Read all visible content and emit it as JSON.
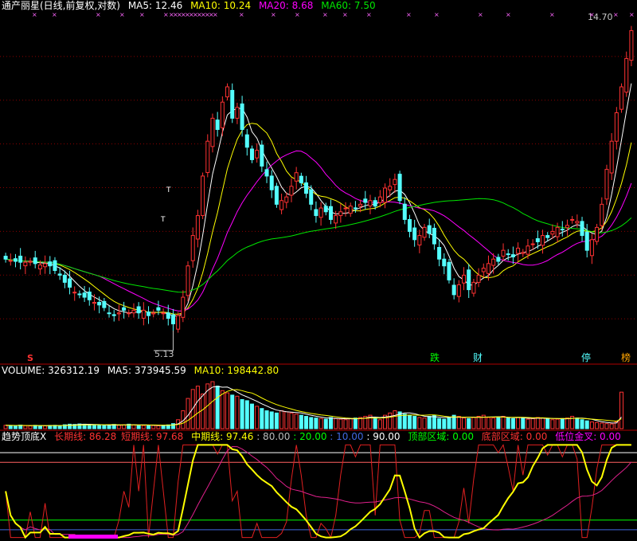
{
  "colors": {
    "up": "#ff3232",
    "down": "#54ffff",
    "ma5": "#ffffff",
    "ma10": "#ffff00",
    "ma20": "#ff00ff",
    "ma60": "#00e600",
    "grid": "#8b0000",
    "panel_border": "#b00000"
  },
  "main_header": {
    "title": "通产丽星(日线,前复权,对数)",
    "ma5": "MA5: 12.46",
    "ma10": "MA10: 10.24",
    "ma20": "MA20: 8.68",
    "ma60": "MA60: 7.50"
  },
  "volume_header": {
    "title": "VOLUME: 326312.19",
    "ma5": "MA5: 373945.59",
    "ma10": "MA10: 198442.80"
  },
  "indicator_header": {
    "title": "趋势顶底X",
    "long": "长期线: 86.28",
    "short": "短期线: 97.68",
    "mid": "中期线: 97.46",
    "l80": ": 80.00",
    "l20": ": 20.00",
    "l10": ": 10.00",
    "l90": ": 90.00",
    "top": "顶部区域: 0.00",
    "bottom": "底部区域: 0.00",
    "cross": "低位金叉: 0.00"
  },
  "annotations": {
    "low_label": "5.13",
    "high_label": "14.70",
    "marker_s": "S",
    "marker_die": "跌",
    "marker_cai": "财",
    "marker_ting": "停",
    "marker_bang": "榜",
    "t_mark": "T"
  },
  "chart_data": [
    {
      "type": "candlestick",
      "title": "通产丽星(日线,前复权,对数)",
      "scale": "log",
      "y_range": [
        4.6,
        15.2
      ],
      "low": 5.13,
      "high": 14.7,
      "closes": [
        6.55,
        6.52,
        6.5,
        6.48,
        6.48,
        6.5,
        6.45,
        6.42,
        6.45,
        6.4,
        6.3,
        6.2,
        6.05,
        5.95,
        5.85,
        5.8,
        5.75,
        5.7,
        5.65,
        5.6,
        5.55,
        5.45,
        5.4,
        5.45,
        5.5,
        5.45,
        5.5,
        5.45,
        5.5,
        5.4,
        5.45,
        5.5,
        5.45,
        5.35,
        5.25,
        5.4,
        5.75,
        6.4,
        7.1,
        7.6,
        8.7,
        9.8,
        10.6,
        10.2,
        11.2,
        11.8,
        10.6,
        11.0,
        10.2,
        9.6,
        9.2,
        9.5,
        9.0,
        8.7,
        8.3,
        7.9,
        8.0,
        8.1,
        8.4,
        8.8,
        8.5,
        8.2,
        7.9,
        7.6,
        7.8,
        7.7,
        7.5,
        7.6,
        7.7,
        7.8,
        7.85,
        7.8,
        7.9,
        7.95,
        8.0,
        7.85,
        8.1,
        8.35,
        8.4,
        8.6,
        8.0,
        7.5,
        7.2,
        7.0,
        7.1,
        7.3,
        7.15,
        6.9,
        6.55,
        6.4,
        6.1,
        5.8,
        6.0,
        6.2,
        5.9,
        6.05,
        6.2,
        6.35,
        6.45,
        6.55,
        6.5,
        6.75,
        6.65,
        6.6,
        6.8,
        6.7,
        6.85,
        6.9,
        6.95,
        7.1,
        7.05,
        7.2,
        7.3,
        7.25,
        7.35,
        7.5,
        7.45,
        7.1,
        6.75,
        7.0,
        7.3,
        7.9,
        8.9,
        9.8,
        10.8,
        11.8,
        13.0,
        14.3
      ]
    },
    {
      "type": "bar",
      "title": "VOLUME",
      "y_range": [
        0,
        470000
      ],
      "values": [
        30000,
        28000,
        27000,
        32000,
        26000,
        25000,
        30000,
        27000,
        25000,
        29000,
        30000,
        28000,
        35000,
        40000,
        38000,
        42000,
        40000,
        36000,
        32000,
        30000,
        28000,
        33000,
        38000,
        30000,
        35000,
        40000,
        33000,
        30000,
        28000,
        32000,
        29000,
        26000,
        30000,
        34000,
        45000,
        80000,
        160000,
        270000,
        350000,
        380000,
        310000,
        400000,
        420000,
        380000,
        340000,
        320000,
        300000,
        290000,
        260000,
        250000,
        220000,
        200000,
        180000,
        160000,
        150000,
        140000,
        160000,
        150000,
        140000,
        130000,
        120000,
        110000,
        100000,
        95000,
        90000,
        85000,
        100000,
        90000,
        85000,
        80000,
        90000,
        95000,
        100000,
        110000,
        120000,
        90000,
        80000,
        120000,
        140000,
        160000,
        150000,
        130000,
        120000,
        110000,
        100000,
        95000,
        110000,
        120000,
        90000,
        85000,
        100000,
        120000,
        110000,
        95000,
        90000,
        100000,
        110000,
        120000,
        100000,
        95000,
        105000,
        110000,
        95000,
        90000,
        100000,
        95000,
        85000,
        90000,
        100000,
        95000,
        90000,
        80000,
        85000,
        90000,
        95000,
        110000,
        95000,
        80000,
        70000,
        60000,
        55000,
        50000,
        45000,
        42000,
        60000,
        326312
      ]
    },
    {
      "type": "line",
      "title": "趋势顶底X",
      "y_range": [
        0,
        100
      ],
      "reference_lines": [
        80,
        20,
        10,
        90
      ],
      "series": [
        {
          "name": "长期线",
          "last": 86.28
        },
        {
          "name": "短期线",
          "last": 97.68
        },
        {
          "name": "中期线",
          "last": 97.46
        }
      ]
    }
  ]
}
